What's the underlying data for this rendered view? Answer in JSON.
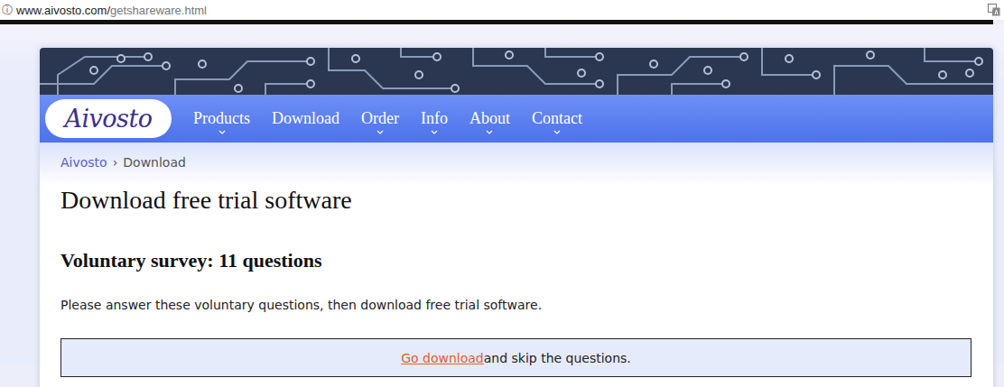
{
  "browser": {
    "info_icon": "ⓘ",
    "url_host": "www.aivosto.com/",
    "url_path": "getshareware.html"
  },
  "logo": "Aivosto",
  "nav": [
    {
      "label": "Products",
      "has_submenu": true
    },
    {
      "label": "Download",
      "has_submenu": false
    },
    {
      "label": "Order",
      "has_submenu": true
    },
    {
      "label": "Info",
      "has_submenu": true
    },
    {
      "label": "About",
      "has_submenu": true
    },
    {
      "label": "Contact",
      "has_submenu": true
    }
  ],
  "breadcrumb": {
    "items": [
      {
        "label": "Aivosto",
        "link": true
      },
      {
        "label": "Download",
        "link": false
      }
    ],
    "separator": "›"
  },
  "title": "Download free trial software",
  "survey": {
    "heading": "Voluntary survey: 11 questions",
    "intro": "Please answer these voluntary questions, then download free trial software.",
    "skip_link": "Go download",
    "skip_text": "and skip the questions."
  }
}
